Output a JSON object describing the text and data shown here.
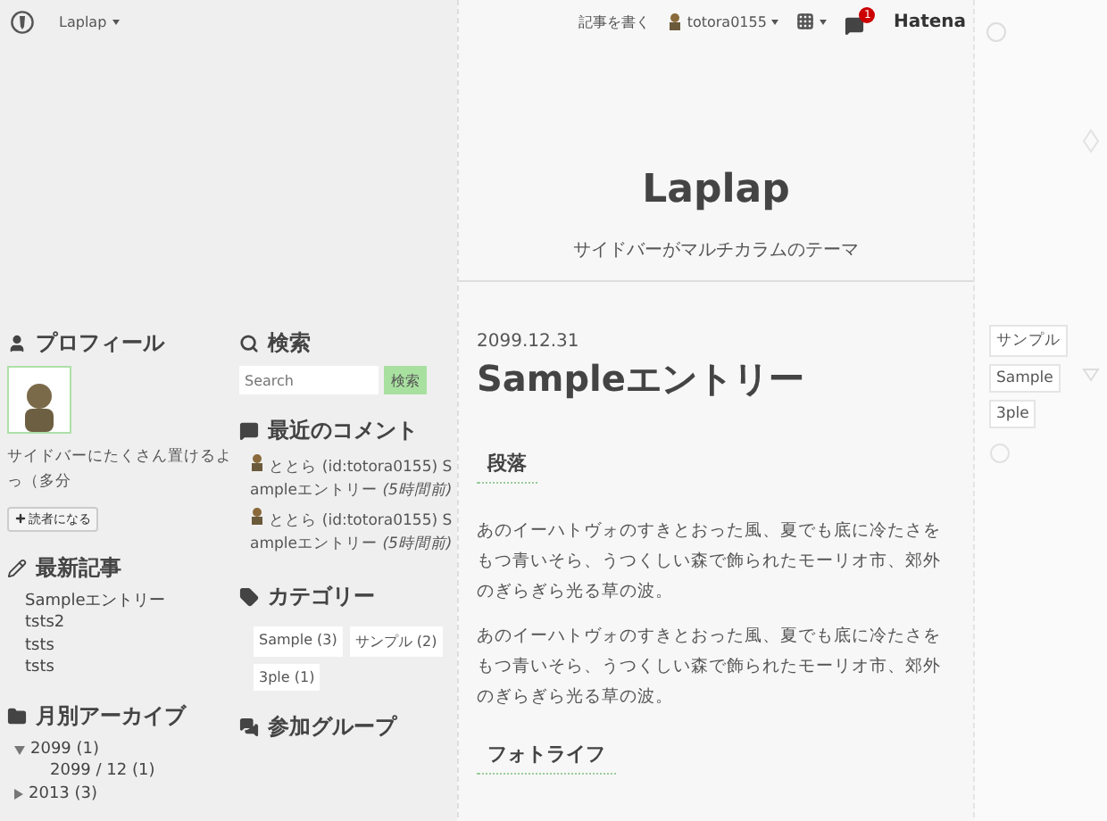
{
  "topbar": {
    "blog_menu": "Laplap",
    "write_link": "記事を書く",
    "user": "totora0155",
    "notification_count": "1",
    "brand": "Hatena"
  },
  "header": {
    "title": "Laplap",
    "subtitle": "サイドバーがマルチカラムのテーマ"
  },
  "sidebar_left": {
    "profile": {
      "heading": "プロフィール",
      "description": "サイドバーにたくさん置けるよっ（多分",
      "follow_button": "読者になる"
    },
    "recent": {
      "heading": "最新記事",
      "items": [
        "Sampleエントリー",
        "tsts2",
        "tsts",
        "tsts"
      ]
    },
    "archive": {
      "heading": "月別アーカイブ",
      "years": [
        {
          "label": "2099 (1)",
          "expanded": true,
          "children": [
            {
              "label": "2099 / 12 (1)"
            }
          ]
        },
        {
          "label": "2013 (3)",
          "expanded": false
        }
      ]
    }
  },
  "sidebar_mid": {
    "search": {
      "heading": "検索",
      "placeholder": "Search",
      "button": "検索"
    },
    "comments": {
      "heading": "最近のコメント",
      "items": [
        {
          "text": "ととら (id:totora0155) Sampleエントリー *(5時間前)*"
        },
        {
          "text": "ととら (id:totora0155) Sampleエントリー *(5時間前)*"
        }
      ]
    },
    "categories": {
      "heading": "カテゴリー",
      "items": [
        "Sample (3)",
        "サンプル (2)",
        "3ple (1)"
      ]
    },
    "groups": {
      "heading": "参加グループ"
    }
  },
  "entry": {
    "date": "2099.12.31",
    "title": "Sampleエントリー",
    "sections": [
      {
        "heading": "段落",
        "paragraphs": [
          "あのイーハトヴォのすきとおった風、夏でも底に冷たさをもつ青いそら、うつくしい森で飾られたモーリオ市、郊外のぎらぎら光る草の波。",
          "あのイーハトヴォのすきとおった風、夏でも底に冷たさをもつ青いそら、うつくしい森で飾られたモーリオ市、郊外のぎらぎら光る草の波。"
        ]
      },
      {
        "heading": "フォトライフ"
      }
    ]
  },
  "right_tags": [
    "サンプル",
    "Sample",
    "3ple"
  ]
}
